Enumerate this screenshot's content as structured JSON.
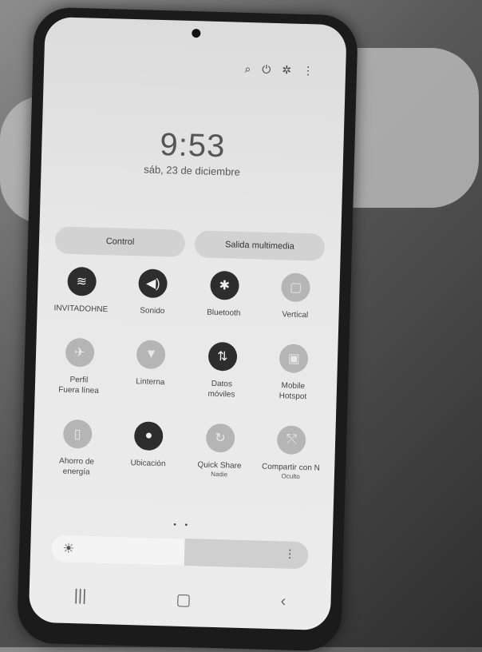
{
  "status_bar": {
    "icons": [
      "search-icon",
      "power-icon",
      "gear-icon",
      "more-icon"
    ]
  },
  "lock": {
    "time": "9:53",
    "date": "sáb, 23 de diciembre"
  },
  "media_pills": [
    "Control",
    "Salida multimedia"
  ],
  "tiles": [
    {
      "id": "wifi",
      "icon": "wifi-icon",
      "glyph": "≋",
      "label": "INVITADOHNE",
      "on": true
    },
    {
      "id": "sound",
      "icon": "speaker-icon",
      "glyph": "◀)",
      "label": "Sonido",
      "on": true
    },
    {
      "id": "bluetooth",
      "icon": "bluetooth-icon",
      "glyph": "✱",
      "label": "Bluetooth",
      "on": true
    },
    {
      "id": "rotation",
      "icon": "lock-rotation-icon",
      "glyph": "▢",
      "label": "Vertical",
      "on": false
    },
    {
      "id": "airplane",
      "icon": "airplane-icon",
      "glyph": "✈",
      "label": "Perfil\nFuera línea",
      "on": false
    },
    {
      "id": "flashlight",
      "icon": "flashlight-icon",
      "glyph": "▼",
      "label": "Linterna",
      "on": false
    },
    {
      "id": "data",
      "icon": "mobile-data-icon",
      "glyph": "⇅",
      "label": "Datos\nmóviles",
      "on": true
    },
    {
      "id": "hotspot",
      "icon": "hotspot-icon",
      "glyph": "▣",
      "label": "Mobile\nHotspot",
      "on": false
    },
    {
      "id": "battery",
      "icon": "battery-saver-icon",
      "glyph": "▯",
      "label": "Ahorro de\nenergía",
      "on": false
    },
    {
      "id": "location",
      "icon": "location-pin-icon",
      "glyph": "●",
      "label": "Ubicación",
      "on": true
    },
    {
      "id": "quickshare",
      "icon": "quick-share-icon",
      "glyph": "↻",
      "label": "Quick Share",
      "sub": "Nadie",
      "on": false
    },
    {
      "id": "share",
      "icon": "share-nearby-icon",
      "glyph": "⤲",
      "label": "Compartir con N",
      "sub": "Oculto",
      "on": false
    }
  ],
  "pager_dots": "• •",
  "brightness": {
    "level": 0.52,
    "icon": "sun-icon"
  },
  "navbar": [
    {
      "name": "recents-button",
      "icon": "recents-icon",
      "glyph": "|||"
    },
    {
      "name": "home-button",
      "icon": "home-icon",
      "glyph": "▢"
    },
    {
      "name": "back-button",
      "icon": "back-icon",
      "glyph": "‹"
    }
  ]
}
